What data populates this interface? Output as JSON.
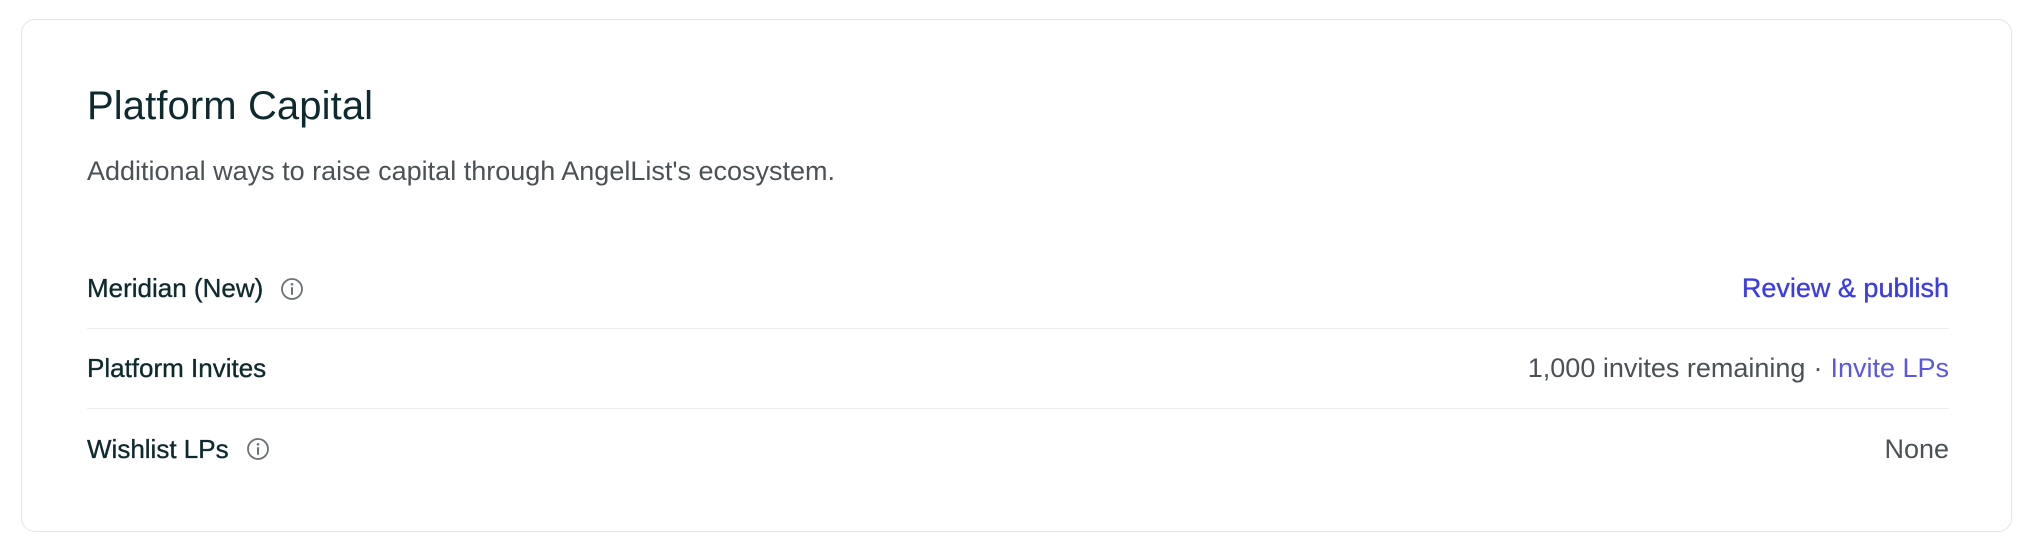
{
  "card": {
    "title": "Platform Capital",
    "subtitle": "Additional ways to raise capital through AngelList's ecosystem."
  },
  "rows": [
    {
      "label": "Meridian (New)",
      "has_info_icon": true,
      "action_label": "Review & publish"
    },
    {
      "label": "Platform Invites",
      "has_info_icon": false,
      "status_text": "1,000 invites remaining",
      "separator": "·",
      "action_label": "Invite LPs"
    },
    {
      "label": "Wishlist LPs",
      "has_info_icon": true,
      "status_text": "None"
    }
  ],
  "colors": {
    "accent_link": "#3b3de3",
    "secondary_link": "#5a57e6",
    "heading_text": "#0f2a2e",
    "muted_text": "#4a5256"
  },
  "icons": {
    "info": "info-circle-icon"
  }
}
